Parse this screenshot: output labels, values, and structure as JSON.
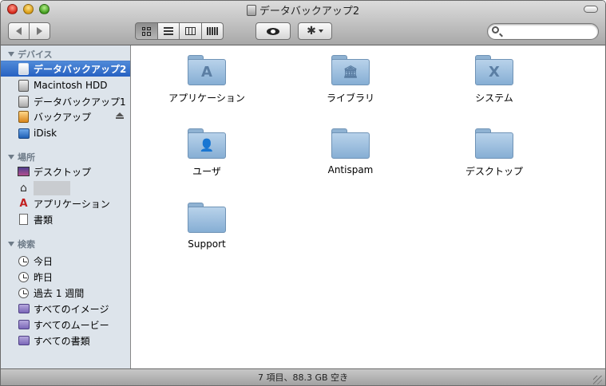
{
  "window": {
    "title": "データバックアップ2"
  },
  "toolbar": {
    "back_icon": "back-arrow-icon",
    "forward_icon": "forward-arrow-icon",
    "view_modes": [
      "icon-view",
      "list-view",
      "column-view",
      "coverflow-view"
    ],
    "selected_view": "icon-view",
    "quick_look_icon": "eye-icon",
    "action_icon": "gear-icon",
    "search": {
      "value": "",
      "placeholder": ""
    }
  },
  "sidebar": {
    "devices_header": "デバイス",
    "devices": [
      {
        "label": "データバックアップ2",
        "icon": "hard-drive-icon",
        "selected": true
      },
      {
        "label": "Macintosh HDD",
        "icon": "hard-drive-icon"
      },
      {
        "label": "データバックアップ1",
        "icon": "hard-drive-icon"
      },
      {
        "label": "バックアップ",
        "icon": "external-drive-icon",
        "ejectable": true
      },
      {
        "label": "iDisk",
        "icon": "idisk-icon"
      }
    ],
    "places_header": "場所",
    "places": [
      {
        "label": "デスクトップ",
        "icon": "desktop-icon"
      },
      {
        "label": "",
        "icon": "home-icon",
        "redacted": true
      },
      {
        "label": "アプリケーション",
        "icon": "applications-icon"
      },
      {
        "label": "書類",
        "icon": "documents-icon"
      }
    ],
    "search_header": "検索",
    "search_for": [
      {
        "label": "今日",
        "icon": "clock-icon"
      },
      {
        "label": "昨日",
        "icon": "clock-icon"
      },
      {
        "label": "過去 1 週間",
        "icon": "clock-icon"
      },
      {
        "label": "すべてのイメージ",
        "icon": "smart-folder-icon"
      },
      {
        "label": "すべてのムービー",
        "icon": "smart-folder-icon"
      },
      {
        "label": "すべての書類",
        "icon": "smart-folder-icon"
      }
    ]
  },
  "content": {
    "items": [
      {
        "label": "アプリケーション",
        "glyph": "A",
        "icon": "applications-folder-icon"
      },
      {
        "label": "ライブラリ",
        "glyph": "🏛",
        "icon": "library-folder-icon"
      },
      {
        "label": "システム",
        "glyph": "X",
        "icon": "system-folder-icon"
      },
      {
        "label": "ユーザ",
        "glyph": "👤",
        "icon": "users-folder-icon"
      },
      {
        "label": "Antispam",
        "glyph": "",
        "icon": "folder-icon"
      },
      {
        "label": "デスクトップ",
        "glyph": "",
        "icon": "folder-icon"
      },
      {
        "label": "Support",
        "glyph": "",
        "icon": "folder-icon"
      }
    ]
  },
  "statusbar": {
    "text": "7 項目、88.3 GB 空き"
  },
  "colors": {
    "sidebar_bg": "#dde4eb",
    "selection": "#2761c2",
    "folder": "#86aed4"
  }
}
